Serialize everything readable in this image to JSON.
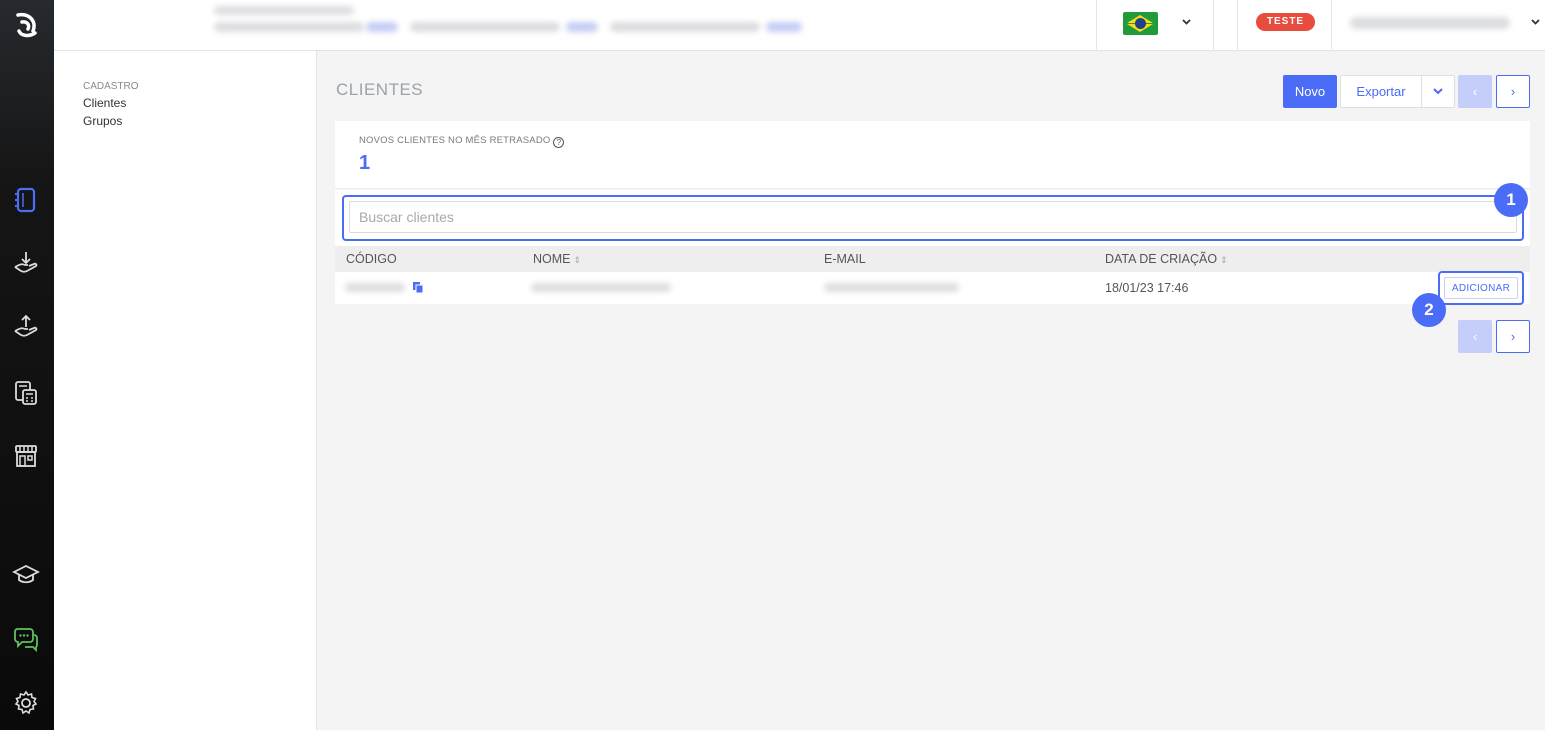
{
  "header": {
    "env_badge": "TESTE",
    "language_flag": "brazil-flag",
    "icons": [
      "chevron-down-icon"
    ]
  },
  "rail": {
    "icons": [
      "app-logo-icon",
      "register-icon",
      "receive-icon",
      "send-icon",
      "calculator-icon",
      "store-icon",
      "academy-icon",
      "chat-icon",
      "settings-icon"
    ]
  },
  "subnav": {
    "group": "CADASTRO",
    "items": [
      {
        "label": "Clientes"
      },
      {
        "label": "Grupos"
      }
    ]
  },
  "main": {
    "title": "CLIENTES",
    "new_label": "Novo",
    "export_label": "Exportar",
    "prev": "‹",
    "next": "›",
    "stat_label": "NOVOS CLIENTES NO MÊS RETRASADO",
    "stat_help": "?",
    "stat_value": "1",
    "search_placeholder": "Buscar clientes",
    "columns": [
      "CÓDIGO",
      "NOME",
      "E-MAIL",
      "DATA DE CRIAÇÃO"
    ],
    "rows": [
      {
        "created": "18/01/23 17:46",
        "action": "ADICIONAR"
      }
    ],
    "callouts": [
      "1",
      "2"
    ]
  },
  "colors": {
    "accent": "#4a6cf7",
    "badge": "#e84c3d",
    "rail": "#111111"
  }
}
